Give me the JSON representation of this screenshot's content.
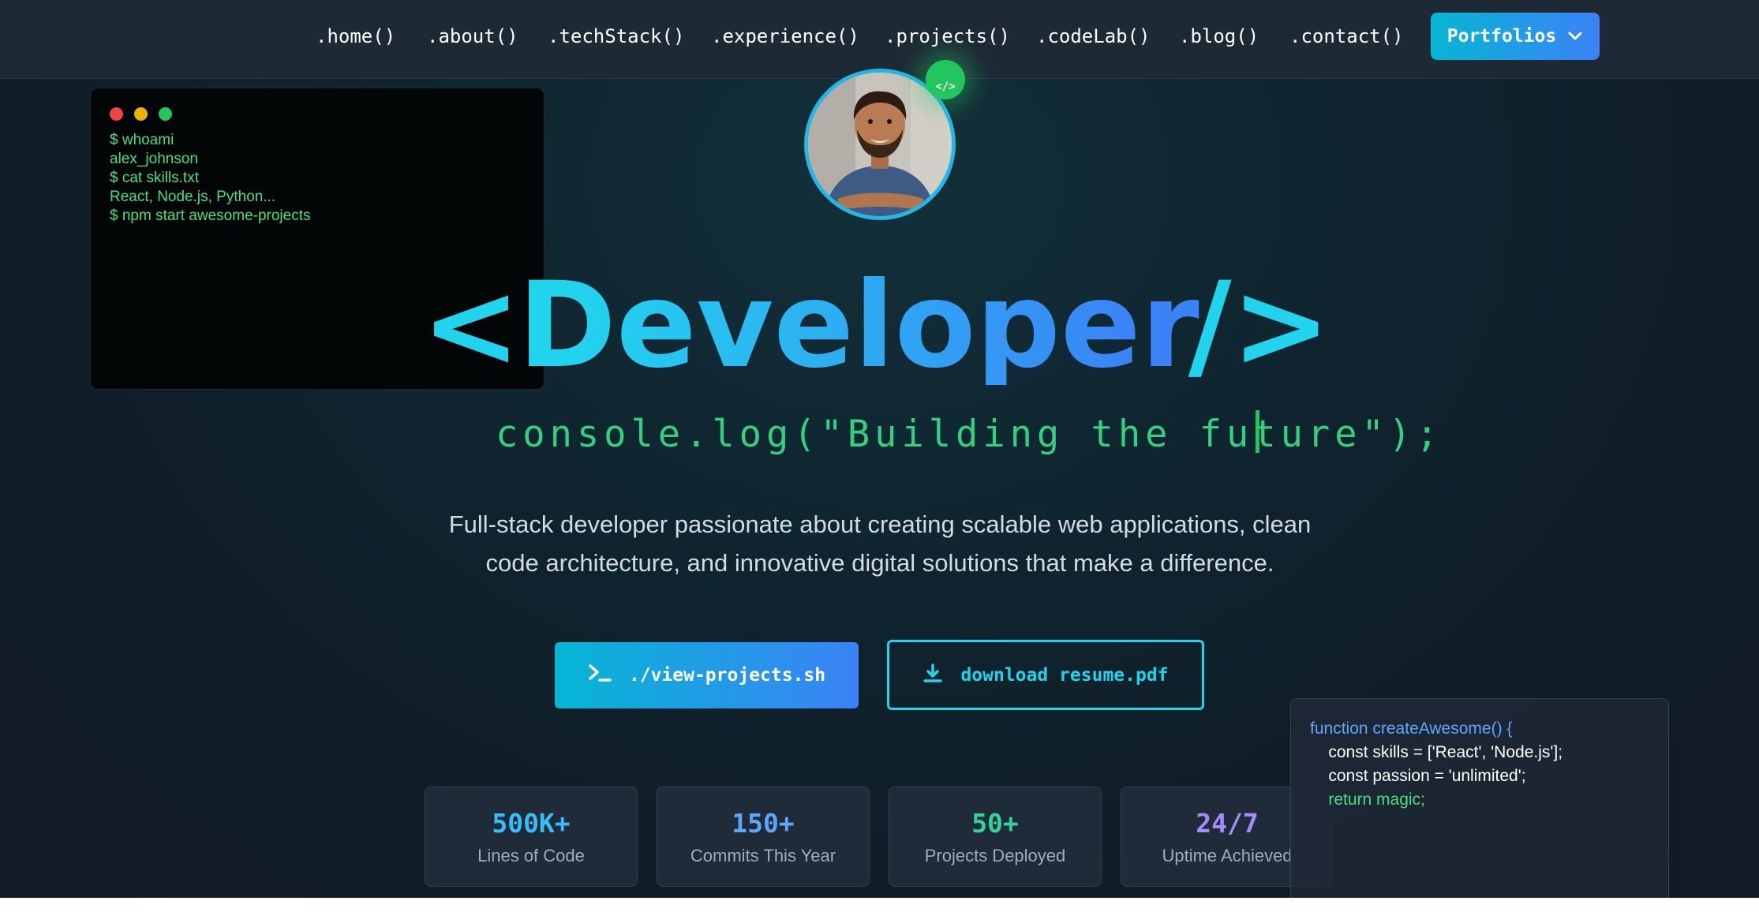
{
  "nav": {
    "links": [
      ".home()",
      ".about()",
      ".techStack()",
      ".experience()",
      ".projects()",
      ".codeLab()",
      ".blog()",
      ".contact()"
    ],
    "portfolios_label": "Portfolios"
  },
  "terminal": {
    "lines": [
      "$ whoami",
      "alex_johnson",
      "$ cat skills.txt",
      "React, Node.js, Python...",
      "$ npm start awesome-projects"
    ]
  },
  "avatar": {
    "badge": "</>"
  },
  "hero": {
    "open": "<",
    "title": "Developer",
    "close": "/>",
    "tagline": "console.log(\"Building the future\");",
    "description_line1": "Full-stack developer passionate about creating scalable web applications, clean",
    "description_line2": "code architecture, and innovative digital solutions that make a difference."
  },
  "buttons": {
    "view_projects": "./view-projects.sh",
    "download_resume": "download resume.pdf"
  },
  "stats": [
    {
      "value": "500K+",
      "label": "Lines of Code",
      "color": "#38bdf8"
    },
    {
      "value": "150+",
      "label": "Commits This Year",
      "color": "#60a5fa"
    },
    {
      "value": "50+",
      "label": "Projects Deployed",
      "color": "#34d399"
    },
    {
      "value": "24/7",
      "label": "Uptime Achieved",
      "color": "#a78bfa"
    }
  ],
  "code": {
    "lines": [
      "function createAwesome() {",
      "    const skills = ['React', 'Node.js'];",
      "    const passion = 'unlimited';",
      "    return magic;"
    ]
  },
  "colors": {
    "accent_cyan": "#22d3ee",
    "accent_blue": "#3b82f6",
    "terminal_green": "#4ade80"
  }
}
